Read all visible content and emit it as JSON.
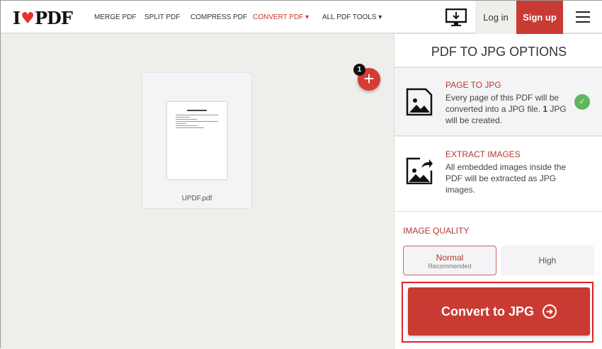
{
  "header": {
    "logo": "I♥PDF",
    "nav": [
      {
        "label": "MERGE PDF"
      },
      {
        "label": "SPLIT PDF"
      },
      {
        "label": "COMPRESS PDF"
      },
      {
        "label": "CONVERT PDF ▾"
      },
      {
        "label": "ALL PDF TOOLS ▾"
      }
    ],
    "login": "Log in",
    "signup": "Sign up"
  },
  "workspace": {
    "file_name": "UPDF.pdf",
    "file_count": "1",
    "add_label": "+"
  },
  "panel": {
    "title": "PDF TO JPG OPTIONS",
    "options": [
      {
        "title": "PAGE TO JPG",
        "desc_a": "Every page of this PDF will be converted into a JPG file. ",
        "count": "1",
        "desc_b": " JPG will be created.",
        "selected": true
      },
      {
        "title": "EXTRACT IMAGES",
        "desc": "All embedded images inside the PDF will be extracted as JPG images."
      }
    ],
    "quality_label": "IMAGE QUALITY",
    "quality": [
      {
        "label": "Normal",
        "sub": "Recommended",
        "selected": true
      },
      {
        "label": "High"
      }
    ],
    "convert": "Convert to JPG"
  },
  "colors": {
    "brand": "#c93a32",
    "check": "#5cb85c"
  }
}
